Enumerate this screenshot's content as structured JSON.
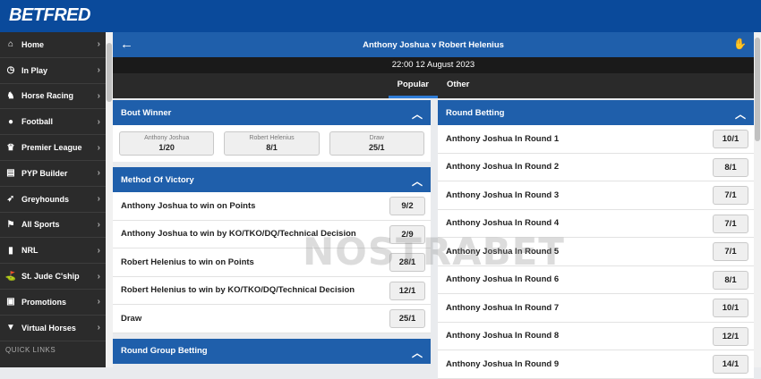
{
  "brand": {
    "logo_main": "BETFRED"
  },
  "sidebar": {
    "items": [
      {
        "label": "Home",
        "icon": "home-icon",
        "glyph": "⌂"
      },
      {
        "label": "In Play",
        "icon": "stopwatch-icon",
        "glyph": "◷"
      },
      {
        "label": "Horse Racing",
        "icon": "horse-icon",
        "glyph": "♞"
      },
      {
        "label": "Football",
        "icon": "football-icon",
        "glyph": "●"
      },
      {
        "label": "Premier League",
        "icon": "trophy-icon",
        "glyph": "♛"
      },
      {
        "label": "PYP Builder",
        "icon": "builder-icon",
        "glyph": "▤"
      },
      {
        "label": "Greyhounds",
        "icon": "greyhound-icon",
        "glyph": "➶"
      },
      {
        "label": "All Sports",
        "icon": "sports-icon",
        "glyph": "⚑"
      },
      {
        "label": "NRL",
        "icon": "rugby-icon",
        "glyph": "▮"
      },
      {
        "label": "St. Jude C'ship",
        "icon": "golf-icon",
        "glyph": "⛳"
      },
      {
        "label": "Promotions",
        "icon": "promotions-icon",
        "glyph": "▣"
      },
      {
        "label": "Virtual Horses",
        "icon": "virtual-horses-icon",
        "glyph": "▼"
      }
    ],
    "quick_links": "QUICK LINKS"
  },
  "event": {
    "title": "Anthony Joshua v Robert Helenius",
    "datetime": "22:00 12 August 2023",
    "tabs": [
      {
        "label": "Popular",
        "active": true
      },
      {
        "label": "Other",
        "active": false
      }
    ]
  },
  "bout_winner": {
    "title": "Bout Winner",
    "selections": [
      {
        "name": "Anthony Joshua",
        "odds": "1/20"
      },
      {
        "name": "Robert Helenius",
        "odds": "8/1"
      },
      {
        "name": "Draw",
        "odds": "25/1"
      }
    ]
  },
  "method_of_victory": {
    "title": "Method Of Victory",
    "rows": [
      {
        "label": "Anthony Joshua to win on Points",
        "odds": "9/2"
      },
      {
        "label": "Anthony Joshua to win by KO/TKO/DQ/Technical Decision",
        "odds": "2/9"
      },
      {
        "label": "Robert Helenius to win on Points",
        "odds": "28/1"
      },
      {
        "label": "Robert Helenius to win by KO/TKO/DQ/Technical Decision",
        "odds": "12/1"
      },
      {
        "label": "Draw",
        "odds": "25/1"
      }
    ]
  },
  "round_group": {
    "title": "Round Group Betting"
  },
  "round_betting": {
    "title": "Round Betting",
    "rows": [
      {
        "label": "Anthony Joshua In Round 1",
        "odds": "10/1"
      },
      {
        "label": "Anthony Joshua In Round 2",
        "odds": "8/1"
      },
      {
        "label": "Anthony Joshua In Round 3",
        "odds": "7/1"
      },
      {
        "label": "Anthony Joshua In Round 4",
        "odds": "7/1"
      },
      {
        "label": "Anthony Joshua In Round 5",
        "odds": "7/1"
      },
      {
        "label": "Anthony Joshua In Round 6",
        "odds": "8/1"
      },
      {
        "label": "Anthony Joshua In Round 7",
        "odds": "10/1"
      },
      {
        "label": "Anthony Joshua In Round 8",
        "odds": "12/1"
      },
      {
        "label": "Anthony Joshua In Round 9",
        "odds": "14/1"
      }
    ]
  },
  "watermark": "NOSTRABET",
  "colors": {
    "brand_blue": "#0a4a9b",
    "market_header": "#1f5fab",
    "brand_red": "#e4002b",
    "sidebar": "#2b2b2b"
  }
}
